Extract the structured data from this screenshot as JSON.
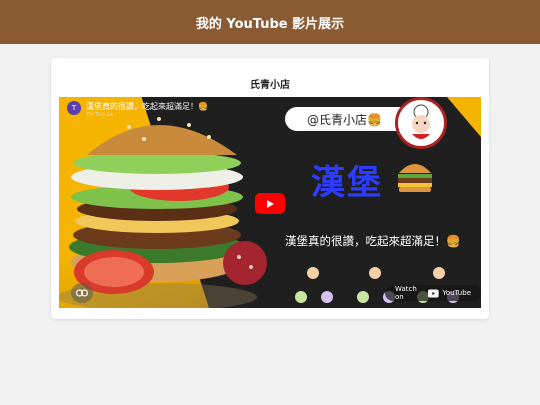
{
  "header": {
    "title": "我的 YouTube 影片展示"
  },
  "card": {
    "title": "氏青小店"
  },
  "video": {
    "title": "漢堡真的很讚，吃起來超滿足！🍔",
    "channel_initial": "T",
    "channel_name": "Thi Tinh Le",
    "handle": "@氏青小店🍔",
    "big_title": "漢堡",
    "tagline": "漢堡真的很讚，吃起來超滿足！🍔",
    "watch_on": "Watch on",
    "watch_brand": "YouTube"
  },
  "colors": {
    "header_bg": "#8a5a33",
    "accent_yellow": "#f4b400",
    "title_blue": "#2d3cff",
    "youtube_red": "#ff0000"
  }
}
